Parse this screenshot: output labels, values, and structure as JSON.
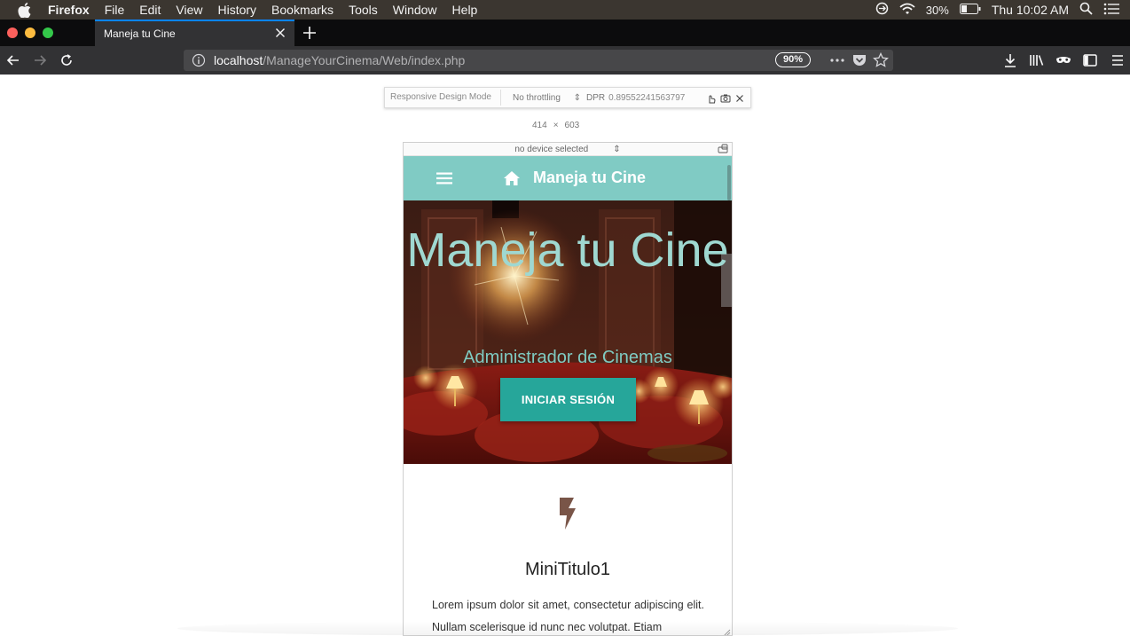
{
  "menubar": {
    "app_name": "Firefox",
    "items": [
      "File",
      "Edit",
      "View",
      "History",
      "Bookmarks",
      "Tools",
      "Window",
      "Help"
    ],
    "battery": "30%",
    "clock": "Thu 10:02 AM"
  },
  "browser": {
    "tab_title": "Maneja tu Cine",
    "url_host": "localhost",
    "url_path": "/ManageYourCinema/Web/index.php",
    "zoom": "90%"
  },
  "rdm": {
    "label": "Responsive Design Mode",
    "throttling": "No throttling",
    "dpr_label": "DPR",
    "dpr_value": "0.89552241563797",
    "width": "414",
    "times": "×",
    "height": "603",
    "device": "no device selected"
  },
  "site": {
    "brand": "Maneja tu Cine",
    "hero_title": "Maneja tu Cine",
    "hero_subtitle": "Administrador de Cinemas",
    "cta_label": "INICIAR SESIÓN",
    "feature_title": "MiniTitulo1",
    "feature_text": "Lorem ipsum dolor sit amet, consectetur adipiscing elit. Nullam scelerisque id nunc nec volutpat. Etiam"
  },
  "colors": {
    "nav_teal": "#80cbc4",
    "button_teal": "#26a69a",
    "hero_text": "#9fd8d1",
    "bolt_brown": "#795548",
    "firefox_accent": "#0a84ff"
  },
  "icons": {
    "apple": "apple-icon",
    "home": "home-icon",
    "menu": "hamburger-icon",
    "feature": "bolt-icon"
  }
}
